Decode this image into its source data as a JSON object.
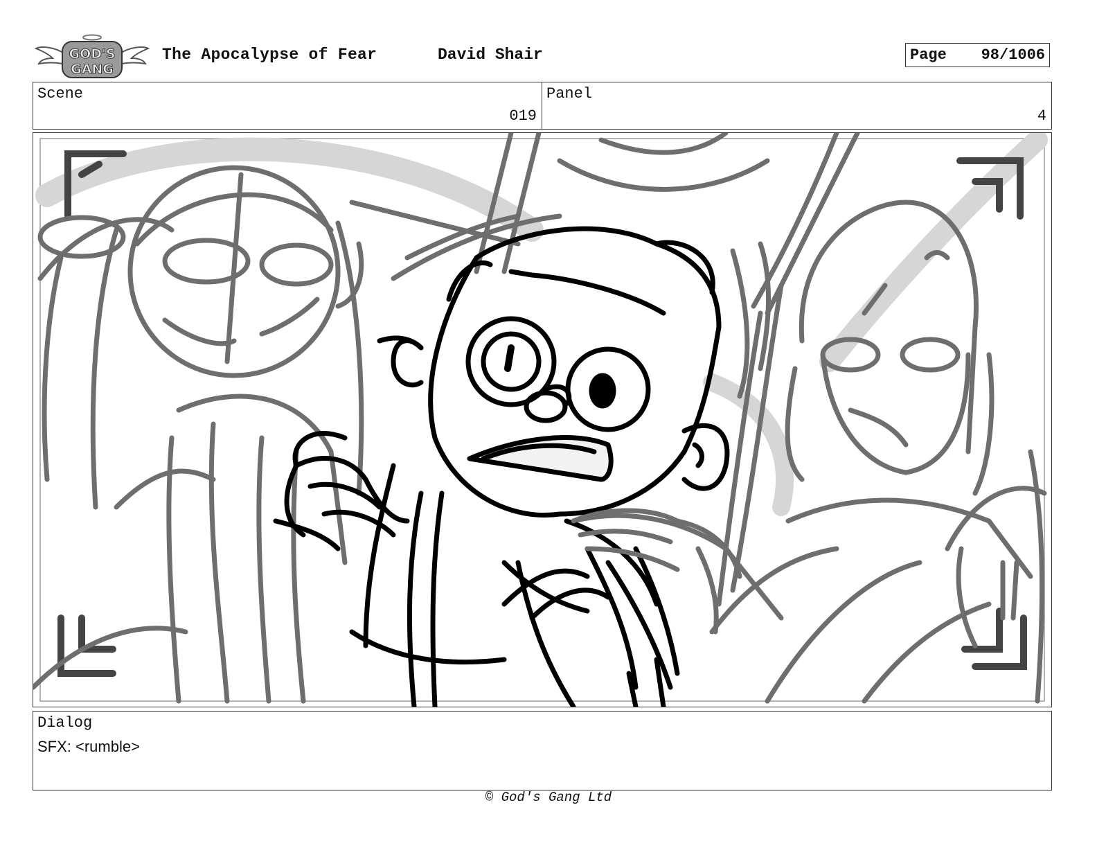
{
  "header": {
    "logo_text": "GOD'S GANG",
    "title": "The Apocalypse of Fear",
    "author": "David Shair",
    "page_label": "Page",
    "page_number": "98/1006"
  },
  "meta": {
    "scene_label": "Scene",
    "scene_value": "019",
    "panel_label": "Panel",
    "panel_value": "4"
  },
  "dialog": {
    "label": "Dialog",
    "lines": [
      "SFX: <rumble>"
    ]
  },
  "footer": {
    "copyright": "© God's Gang Ltd"
  },
  "colors": {
    "ink": "#000000",
    "rough_sketch": "#6e6e6e",
    "light_tone": "#d6d6d6",
    "border": "#333333"
  }
}
